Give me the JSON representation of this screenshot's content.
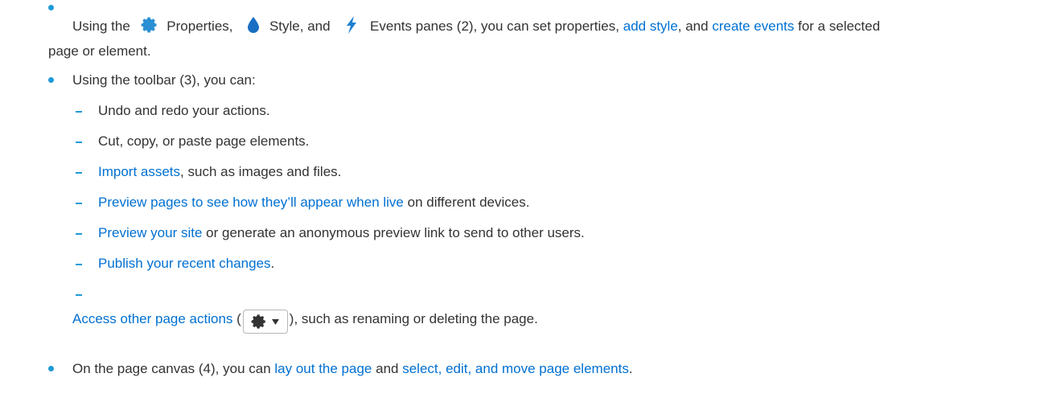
{
  "bullet1": {
    "part1": "Using the",
    "properties_label": "Properties,",
    "style_label": "Style, and",
    "events_label": "Events panes (2), you can set properties,",
    "link_add_style": "add style",
    "part2": ", and",
    "link_create_events": "create events",
    "part3": "for a selected",
    "line2": "page or element."
  },
  "bullet2": {
    "text": "Using the toolbar (3), you can:",
    "items": [
      {
        "text": "Undo and redo your actions."
      },
      {
        "text": "Cut, copy, or paste page elements."
      },
      {
        "link": "Import assets",
        "text": ", such as images and files."
      },
      {
        "link": "Preview pages to see how they’ll appear when live",
        "text": " on different devices."
      },
      {
        "link": "Preview your site",
        "text": " or generate an anonymous preview link to send to other users."
      },
      {
        "link": "Publish your recent changes",
        "text": "."
      },
      {
        "link": "Access other page actions",
        "pre_button": " (",
        "post_button": "), such as renaming or deleting the page.",
        "button_icons": [
          "gear-icon",
          "caret-down-icon"
        ]
      }
    ]
  },
  "bullet3": {
    "part1": "On the page canvas (4), you can",
    "link_layout": "lay out the page",
    "part2": "and",
    "link_select": "select, edit, and move page elements",
    "part3": "."
  },
  "colors": {
    "text": "#333333",
    "link": "#0070d2",
    "bullet": "#1e9bd7",
    "properties_icon": "#2a8fd3",
    "style_icon": "#1a6fc4",
    "events_icon": "#1f7fd0"
  }
}
